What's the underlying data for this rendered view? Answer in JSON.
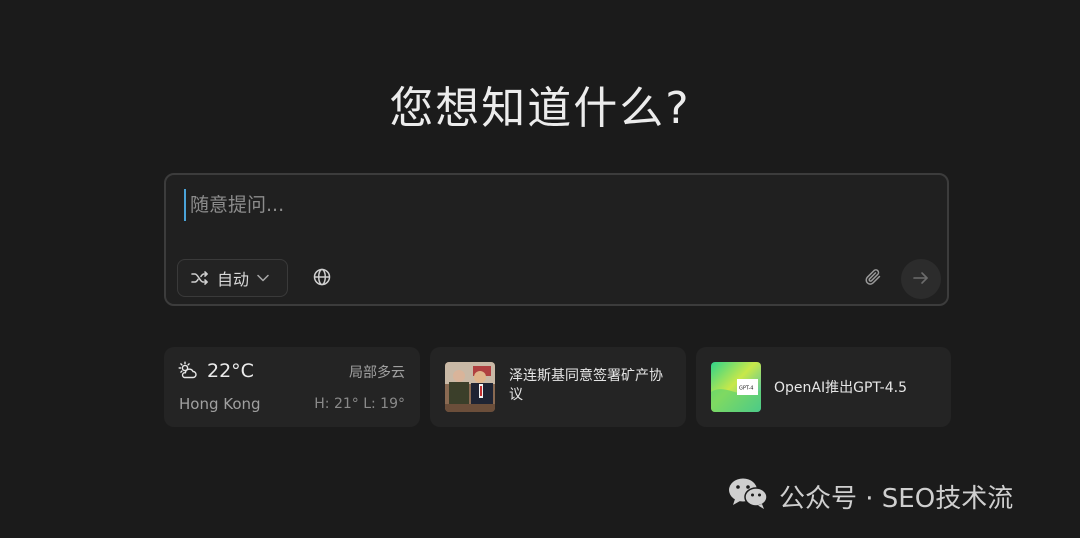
{
  "headline": "您想知道什么?",
  "composer": {
    "placeholder": "随意提问...",
    "mode_label": "自动",
    "mode_icon": "shuffle-icon",
    "web_search_icon": "globe-icon",
    "attach_icon": "paperclip-icon",
    "send_icon": "arrow-right-icon"
  },
  "weather": {
    "icon": "partly-cloudy-icon",
    "temperature": "22°C",
    "condition": "局部多云",
    "location": "Hong Kong",
    "high_low": "H: 21° L: 19°"
  },
  "news": {
    "title": "泽连斯基同意签署矿产协议",
    "thumbnail": "news-photo"
  },
  "gpt": {
    "title": "OpenAI推出GPT-4.5",
    "thumbnail_text": "GPT-4"
  },
  "watermark": {
    "text": "公众号 · SEO技术流",
    "icon": "wechat-icon"
  },
  "colors": {
    "background": "#1b1b1b",
    "card": "#242424",
    "border": "#3c3c3c",
    "cursor": "#4aa3d8"
  }
}
